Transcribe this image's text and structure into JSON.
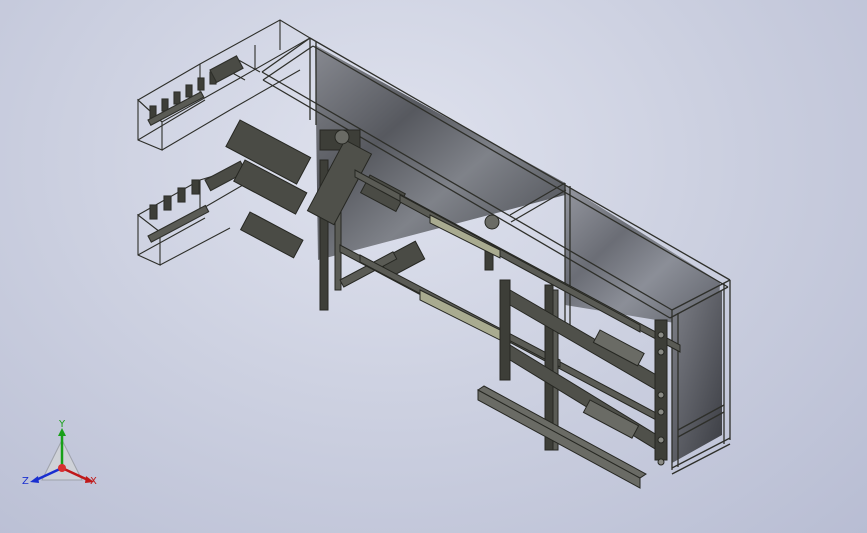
{
  "viewport": {
    "background_top": "#dfe2ee",
    "background_bottom": "#b8bdd3",
    "model_color": "#3d3e38",
    "panel_color": "#55575a"
  },
  "triad": {
    "x_label": "X",
    "y_label": "Y",
    "z_label": "Z",
    "x_color": "#c01818",
    "y_color": "#18a018",
    "z_color": "#1a2fd0"
  }
}
